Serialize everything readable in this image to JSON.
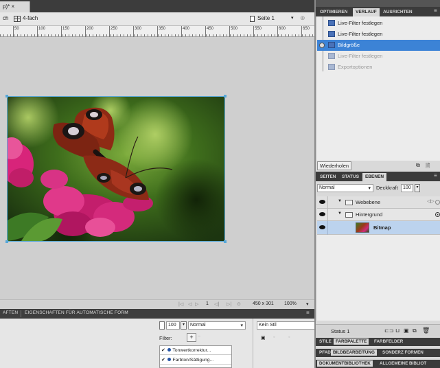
{
  "document": {
    "tab_title": "p)* ×",
    "toolbar": {
      "view_fragment": "ch",
      "four_up": "4-fach",
      "page": "Seite 1"
    },
    "ruler_labels": [
      "50",
      "100",
      "150",
      "200",
      "250",
      "300",
      "350",
      "400",
      "450",
      "500",
      "550",
      "600",
      "650"
    ],
    "status": {
      "frame": "1",
      "size": "450 x 301",
      "zoom": "100%"
    }
  },
  "property_inspector": {
    "tab_left": "AFTEN",
    "tab_auto": "EIGENSCHAFTEN FÜR AUTOMATISCHE FORM",
    "opacity": "100",
    "blend_mode": "Normal",
    "style": "Kein Stil",
    "filter_label": "Filter:",
    "filters": [
      "Tonwertkorrektur...",
      "Farbton/Sättigung..."
    ]
  },
  "history_panel": {
    "tabs": [
      "OPTIMIEREN",
      "VERLAUF",
      "AUSRICHTEN"
    ],
    "active_tab": "VERLAUF",
    "items": [
      {
        "label": "Live-Filter festlegen",
        "state": "normal"
      },
      {
        "label": "Live-Filter festlegen",
        "state": "normal"
      },
      {
        "label": "Bildgröße",
        "state": "selected"
      },
      {
        "label": "Live-Filter festlegen",
        "state": "dimmed"
      },
      {
        "label": "Exportoptionen",
        "state": "dimmed"
      }
    ],
    "repeat_button": "Wiederholen"
  },
  "layers_panel": {
    "tabs": [
      "SEITEN",
      "STATUS",
      "EBENEN"
    ],
    "active_tab": "EBENEN",
    "blend_mode": "Normal",
    "opacity_label": "Deckkraft",
    "opacity_value": "100",
    "layers": [
      {
        "name": "Webebene",
        "type": "folder"
      },
      {
        "name": "Hintergrund",
        "type": "folder"
      },
      {
        "name": "Bitmap",
        "type": "bitmap"
      }
    ],
    "status_label": "Status 1"
  },
  "bottom_tabs": {
    "row1": [
      "STILE",
      "FARBPALETTE",
      "FARBFELDER"
    ],
    "row2": [
      "PFAD",
      "BILDBEARBEITUNG",
      "SONDERZ FORMEN"
    ],
    "row3": [
      "DOKUMENTBIBLIOTHEK",
      "ALLGEMEINE BIBLIOT"
    ]
  },
  "colors": {
    "selection_blue": "#3c83d6",
    "panel_dark": "#3b3b3b",
    "frame_blue": "#58a8d8"
  }
}
